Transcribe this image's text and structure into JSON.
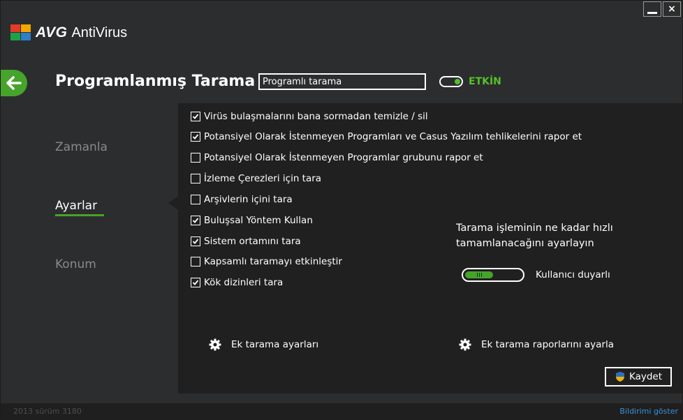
{
  "window": {
    "brand": "AVG",
    "product": "AntiVirus",
    "minimize_icon": "minimize-icon",
    "close_label": "×"
  },
  "header": {
    "title": "Programlanmış Tarama",
    "scan_name_value": "Programlı tarama",
    "toggle_label": "ETKİN",
    "toggle_on": true,
    "accent_color": "#56c02b"
  },
  "nav": {
    "items": [
      {
        "label": "Zamanla",
        "active": false
      },
      {
        "label": "Ayarlar",
        "active": true
      },
      {
        "label": "Konum",
        "active": false
      }
    ]
  },
  "settings": {
    "options": [
      {
        "label": "Virüs bulaşmalarını bana sormadan temizle / sil",
        "checked": true
      },
      {
        "label": "Potansiyel Olarak İstenmeyen Programları ve Casus Yazılım tehlikelerini rapor et",
        "checked": true
      },
      {
        "label": "Potansiyel Olarak İstenmeyen Programlar grubunu rapor et",
        "checked": false
      },
      {
        "label": "İzleme Çerezleri için tara",
        "checked": false
      },
      {
        "label": "Arşivlerin içini tara",
        "checked": false
      },
      {
        "label": "Buluşsal Yöntem Kullan",
        "checked": true
      },
      {
        "label": "Sistem ortamını tara",
        "checked": true
      },
      {
        "label": "Kapsamlı taramayı etkinleştir",
        "checked": false
      },
      {
        "label": "Kök dizinleri tara",
        "checked": true
      }
    ],
    "speed_text_line1": "Tarama işleminin ne kadar hızlı",
    "speed_text_line2": "tamamlanacağını ayarlayın",
    "speed_label": "Kullanıcı duyarlı",
    "speed_level_fraction": 0.33,
    "extra_scan_settings": "Ek tarama ayarları",
    "extra_report_settings": "Ek tarama raporlarını ayarla",
    "save_label": "Kaydet"
  },
  "footer": {
    "version": "2013  sürüm 3180",
    "show_notification": "Bildirimi göster"
  }
}
